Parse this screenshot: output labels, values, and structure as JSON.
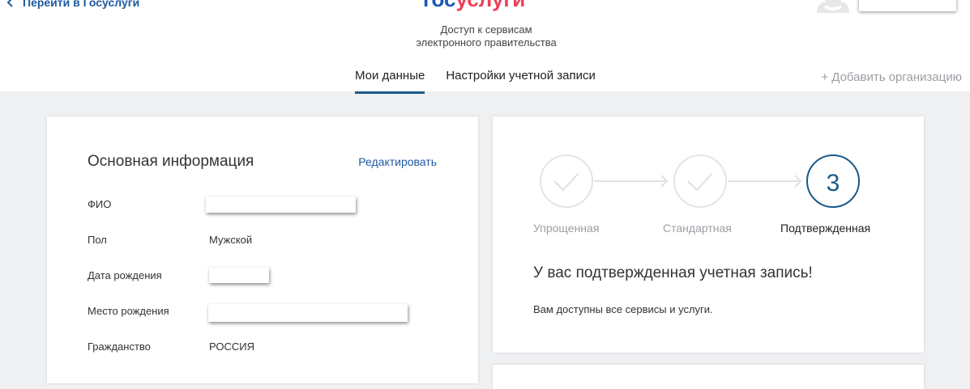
{
  "header": {
    "back_link": "Перейти в Госуслуги",
    "logo_part1": "гос",
    "logo_part2": "услуги",
    "tagline_line1": "Доступ к сервисам",
    "tagline_line2": "электронного правительства"
  },
  "tabs": [
    {
      "label": "Мои данные",
      "active": true
    },
    {
      "label": "Настройки учетной записи",
      "active": false
    }
  ],
  "add_org": "+ Добавить организацию",
  "main_info": {
    "title": "Основная информация",
    "edit_label": "Редактировать",
    "rows": [
      {
        "label": "ФИО",
        "value": ""
      },
      {
        "label": "Пол",
        "value": "Мужской"
      },
      {
        "label": "Дата рождения",
        "value": ""
      },
      {
        "label": "Место рождения",
        "value": ""
      },
      {
        "label": "Гражданство",
        "value": "РОССИЯ"
      }
    ]
  },
  "account_level": {
    "steps": [
      {
        "label": "Упрощенная",
        "status": "completed"
      },
      {
        "label": "Стандартная",
        "status": "completed"
      },
      {
        "label": "Подтвержденная",
        "status": "current",
        "number": "3"
      }
    ],
    "message_title": "У вас подтвержденная учетная запись!",
    "message_text": "Вам доступны все сервисы и услуги."
  },
  "colors": {
    "accent": "#1a5a8a",
    "link": "#1d5aa0",
    "logo_blue": "#1b55b5",
    "logo_red": "#ee3f58",
    "muted": "#9a9ea3",
    "background": "#eef0f2"
  },
  "icons": [
    "chevron-left-icon",
    "avatar-icon",
    "checkmark-icon"
  ]
}
